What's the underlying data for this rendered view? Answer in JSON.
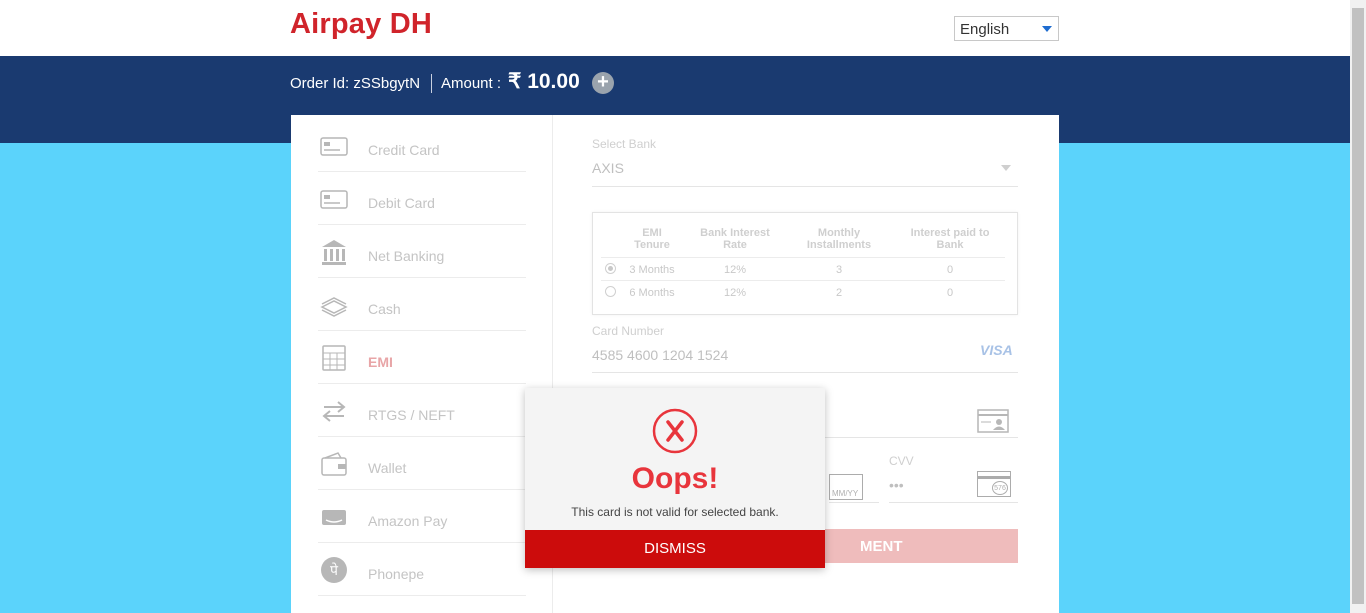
{
  "header": {
    "logo": "Airpay DH",
    "language": {
      "selected": "English"
    }
  },
  "order": {
    "order_id_text": "Order Id: zSSbgytN",
    "amount_label": "Amount :",
    "amount_value": "₹ 10.00",
    "expand_symbol": "+"
  },
  "sidebar": {
    "items": [
      {
        "label": "Credit Card",
        "icon": "credit-card-icon"
      },
      {
        "label": "Debit Card",
        "icon": "debit-card-icon"
      },
      {
        "label": "Net Banking",
        "icon": "bank-icon"
      },
      {
        "label": "Cash",
        "icon": "cash-icon"
      },
      {
        "label": "EMI",
        "icon": "calculator-icon",
        "active": true
      },
      {
        "label": "RTGS / NEFT",
        "icon": "transfer-arrows-icon"
      },
      {
        "label": "Wallet",
        "icon": "wallet-icon"
      },
      {
        "label": "Amazon Pay",
        "icon": "amazon-pay-icon"
      },
      {
        "label": "Phonepe",
        "icon": "phonepe-icon"
      }
    ]
  },
  "form": {
    "bank_label": "Select Bank",
    "bank_value": "AXIS",
    "emi_table": {
      "headers": [
        "EMI Tenure",
        "Bank Interest Rate",
        "Monthly Installments",
        "Interest paid to Bank"
      ],
      "rows": [
        {
          "tenure": "3 Months",
          "rate": "12%",
          "installments": "3",
          "interest": "0",
          "selected": true
        },
        {
          "tenure": "6 Months",
          "rate": "12%",
          "installments": "2",
          "interest": "0",
          "selected": false
        }
      ]
    },
    "card_number_label": "Card Number",
    "card_number_value": "4585 4600 1204 1524",
    "card_brand": "VISA",
    "expiry_hint": "MM/YY",
    "cvv_label": "CVV",
    "cvv_value": "•••",
    "cvv_hint": "576",
    "pay_button_visible_text": "MENT"
  },
  "modal": {
    "title": "Oops!",
    "message": "This card is not valid for selected bank.",
    "dismiss_label": "DISMISS"
  },
  "colors": {
    "brand_red": "#d0242b",
    "nav_blue": "#1a3a70",
    "background_cyan": "#5bd3fb",
    "error_red": "#e8353c",
    "dismiss_red": "#cc0c0c"
  }
}
